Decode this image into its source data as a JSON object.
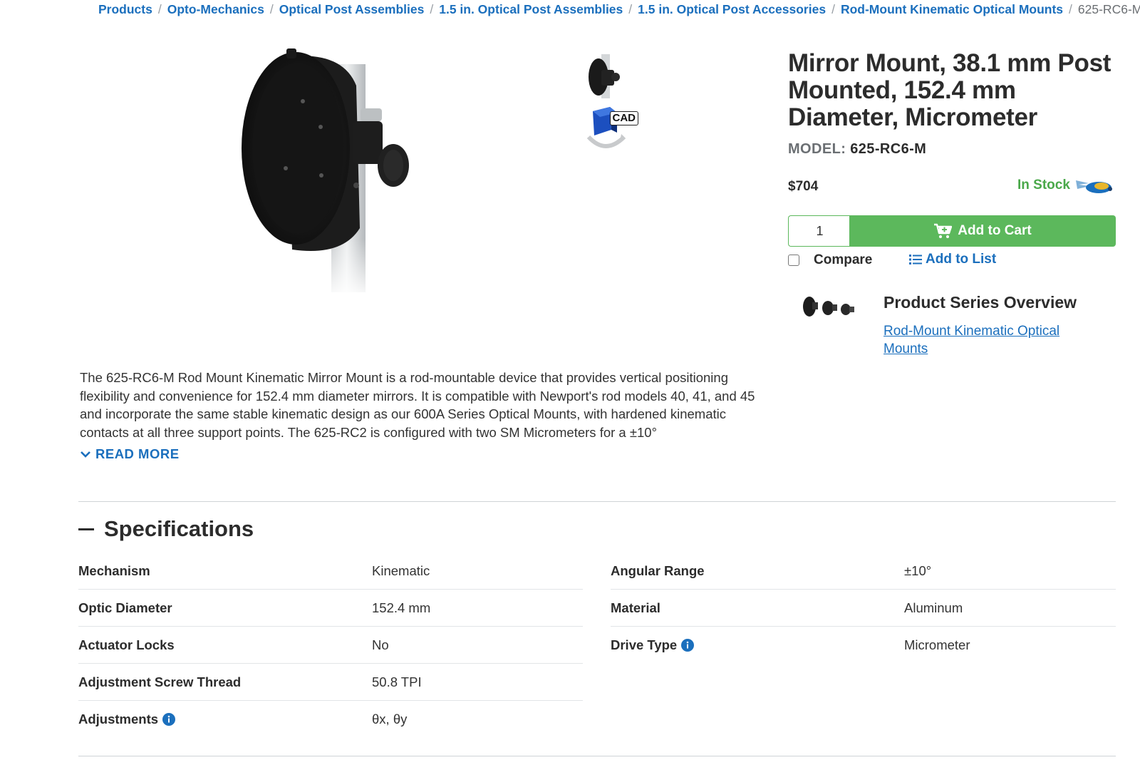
{
  "breadcrumb": {
    "items": [
      "Products",
      "Opto-Mechanics",
      "Optical Post Assemblies",
      "1.5 in. Optical Post Assemblies",
      "1.5 in. Optical Post Accessories",
      "Rod-Mount Kinematic Optical Mounts"
    ],
    "current": "625-RC6-M",
    "separator": "/"
  },
  "gallery": {
    "cad_badge": "CAD",
    "main_image_icon": "mirror-mount-product-image",
    "thumbnail_icons": [
      "mirror-mount-thumbnail",
      "cad-3d-model-icon"
    ]
  },
  "product": {
    "title": "Mirror Mount, 38.1 mm Post Mounted, 152.4 mm Diameter, Micrometer",
    "model_label": "MODEL:",
    "model_value": "625-RC6-M",
    "price": "$704",
    "stock": "In Stock",
    "quantity": "1",
    "add_to_cart": "Add to Cart",
    "compare": "Compare",
    "add_to_list": "Add to List"
  },
  "series": {
    "title": "Product Series Overview",
    "link": "Rod-Mount Kinematic Optical Mounts"
  },
  "description": {
    "text": "The 625-RC6-M Rod Mount Kinematic Mirror Mount is a rod-mountable device that provides vertical positioning flexibility and convenience for 152.4 mm diameter mirrors. It is compatible with Newport's rod models 40, 41, and 45 and incorporate the same stable kinematic design as our 600A Series Optical Mounts, with hardened kinematic contacts at all three support points. The 625-RC2 is configured with two SM Micrometers for a ±10°",
    "read_more": "READ MORE"
  },
  "specifications": {
    "title": "Specifications",
    "left": [
      {
        "key": "Mechanism",
        "value": "Kinematic",
        "info": false
      },
      {
        "key": "Optic Diameter",
        "value": "152.4 mm",
        "info": false
      },
      {
        "key": "Actuator Locks",
        "value": "No",
        "info": false
      },
      {
        "key": "Adjustment Screw Thread",
        "value": "50.8 TPI",
        "info": false
      },
      {
        "key": "Adjustments",
        "value": "θx, θy",
        "info": true
      }
    ],
    "right": [
      {
        "key": "Angular Range",
        "value": "±10°",
        "info": false
      },
      {
        "key": "Material",
        "value": "Aluminum",
        "info": false
      },
      {
        "key": "Drive Type",
        "value": "Micrometer",
        "info": true
      }
    ]
  },
  "colors": {
    "link": "#1b6fbd",
    "green": "#5cb85c",
    "stock_green": "#4aa84a",
    "text_dark": "#2c2c2c"
  }
}
